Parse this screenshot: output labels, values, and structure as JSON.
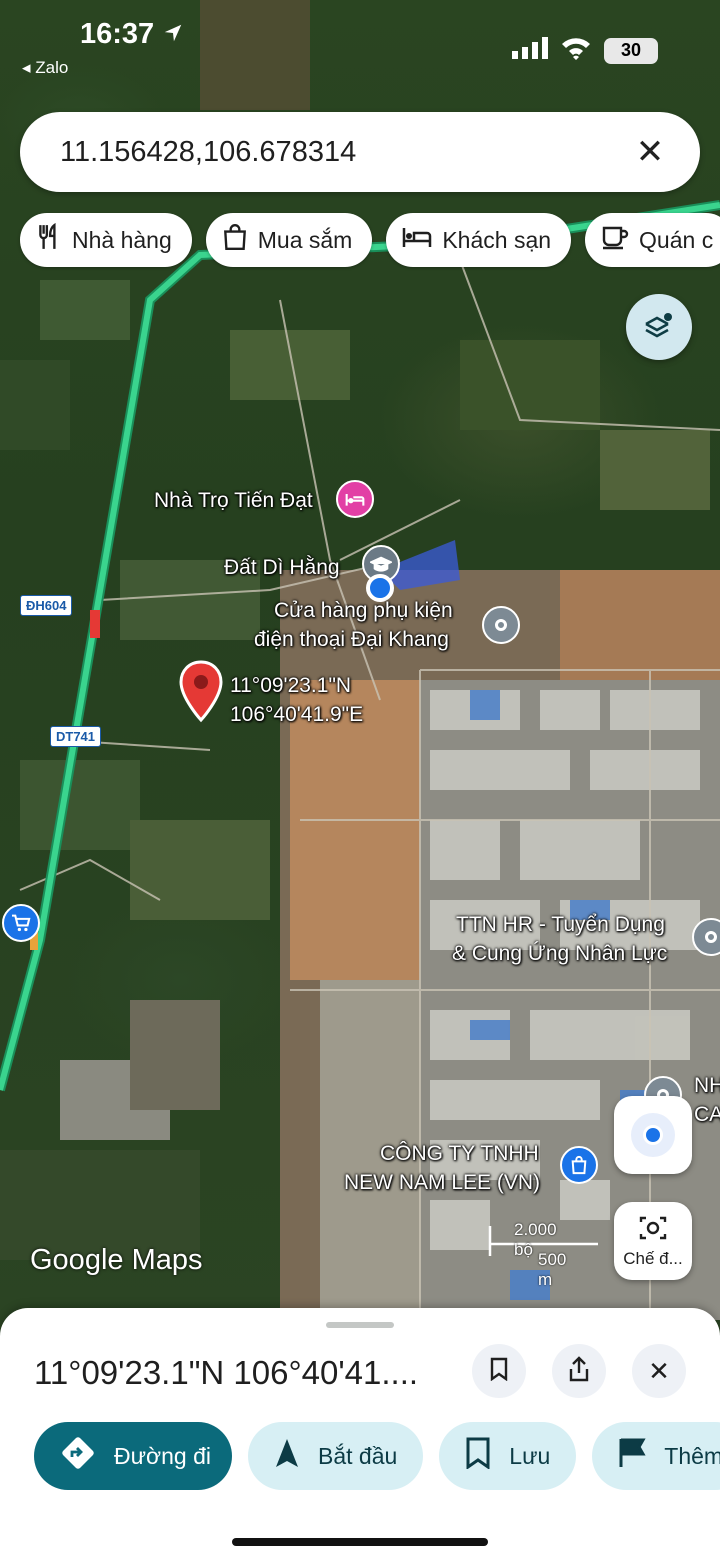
{
  "status_bar": {
    "time": "16:37",
    "back_app": "◂ Zalo",
    "battery": "30"
  },
  "search": {
    "value": "11.156428,106.678314"
  },
  "chips": [
    {
      "label": "Nhà hàng",
      "icon": "restaurant-icon"
    },
    {
      "label": "Mua sắm",
      "icon": "shopping-bag-icon"
    },
    {
      "label": "Khách sạn",
      "icon": "hotel-bed-icon"
    },
    {
      "label": "Quán c",
      "icon": "coffee-cup-icon"
    }
  ],
  "map": {
    "places": {
      "nha_tro": "Nhà Trọ Tiến Đạt",
      "dat_di_hang": "Đất Dì Hằng",
      "cua_hang_line1": "Cửa hàng phụ kiện",
      "cua_hang_line2": "điện thoại Đại Khang",
      "ttn_line1": "TTN HR - Tuyển Dụng",
      "ttn_line2": "& Cung Ứng Nhân Lực",
      "cong_ty_line1": "CÔNG TY TNHH",
      "cong_ty_line2": "NEW NAM LEE (VN)",
      "edge_line1": "NH",
      "edge_line2": "CA"
    },
    "pin": {
      "lat": "11°09'23.1\"N",
      "lng": "106°40'41.9\"E"
    },
    "roads": {
      "dh604": "ĐH604",
      "dt741": "DT741"
    },
    "scale": {
      "feet": "2.000 bộ",
      "meters": "500 m"
    },
    "logo": "Google Maps",
    "camera_label": "Chế đ..."
  },
  "sheet": {
    "title": "11°09'23.1\"N 106°40'41....",
    "actions": [
      {
        "label": "Đường đi",
        "icon": "directions-icon"
      },
      {
        "label": "Bắt đầu",
        "icon": "navigation-arrow-icon"
      },
      {
        "label": "Lưu",
        "icon": "bookmark-icon"
      },
      {
        "label": "Thêm",
        "icon": "flag-icon"
      }
    ]
  },
  "colors": {
    "primary": "#0b6a7b",
    "secondary": "#d7eff4",
    "pin": "#e53935",
    "route": "#3ad48e"
  }
}
